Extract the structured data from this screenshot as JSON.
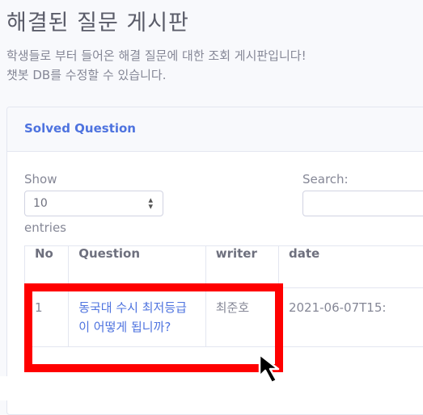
{
  "page": {
    "title": "해결된 질문 게시판",
    "description_line1": "학생들로 부터 들어온 해결 질문에 대한 조회 게시판입니다!",
    "description_line2": "챗봇 DB를 수정할 수 있습니다."
  },
  "card": {
    "header": "Solved Question"
  },
  "controls": {
    "show_label": "Show",
    "entries_value": "10",
    "entries_label": "entries",
    "search_label": "Search:",
    "search_value": ""
  },
  "table": {
    "columns": [
      "No",
      "Question",
      "writer",
      "date"
    ],
    "rows": [
      {
        "no": "1",
        "question": "동국대 수시 최저등급이 어떻게 됩니까?",
        "writer": "최준호",
        "date": "2021-06-07T15:"
      }
    ]
  },
  "colors": {
    "accent": "#4e73df",
    "highlight": "#ff0000"
  },
  "icons": {
    "cursor": "mouse-pointer-icon",
    "select_caret": "sort-caret-icon"
  }
}
